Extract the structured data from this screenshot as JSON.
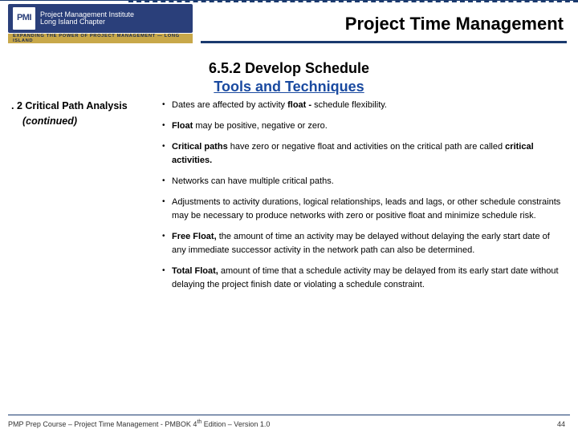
{
  "logo": {
    "mark": "PMI",
    "line1": "Project Management Institute",
    "line2": "Long Island Chapter",
    "tagline": "Expanding the Power of Project Management — Long Island"
  },
  "slide_title": "Project Time Management",
  "section": {
    "number_line": "6.5.2  Develop Schedule",
    "sub_line": "Tools and Techniques"
  },
  "left": {
    "heading": ". 2 Critical Path Analysis",
    "continued": "(continued)"
  },
  "bullets": {
    "b1a": "Dates are affected by activity ",
    "b1b": "float - ",
    "b1c": "schedule flexibility.",
    "b2a": "Float ",
    "b2b": "may be positive, negative or zero.",
    "b3a": "Critical paths ",
    "b3b": "have zero or negative float and activities on the critical path are called ",
    "b3c": "critical activities.",
    "b4": "Networks can have multiple critical paths.",
    "b5": "Adjustments to activity durations, logical relationships, leads and lags, or other schedule constraints may be necessary to produce networks with zero or positive float and minimize schedule risk.",
    "b6a": "Free Float, ",
    "b6b": "the amount of time an activity may be delayed without delaying the early start date of any immediate successor activity in the network path can also be determined.",
    "b7a": "Total Float, ",
    "b7b": "amount of time that a schedule activity may be delayed from its early start date without delaying the project finish date or violating a schedule constraint."
  },
  "footer": {
    "text_a": "PMP Prep Course – Project Time Management - PMBOK 4",
    "text_sup": "th",
    "text_b": " Edition – Version 1.0",
    "page": "44"
  }
}
